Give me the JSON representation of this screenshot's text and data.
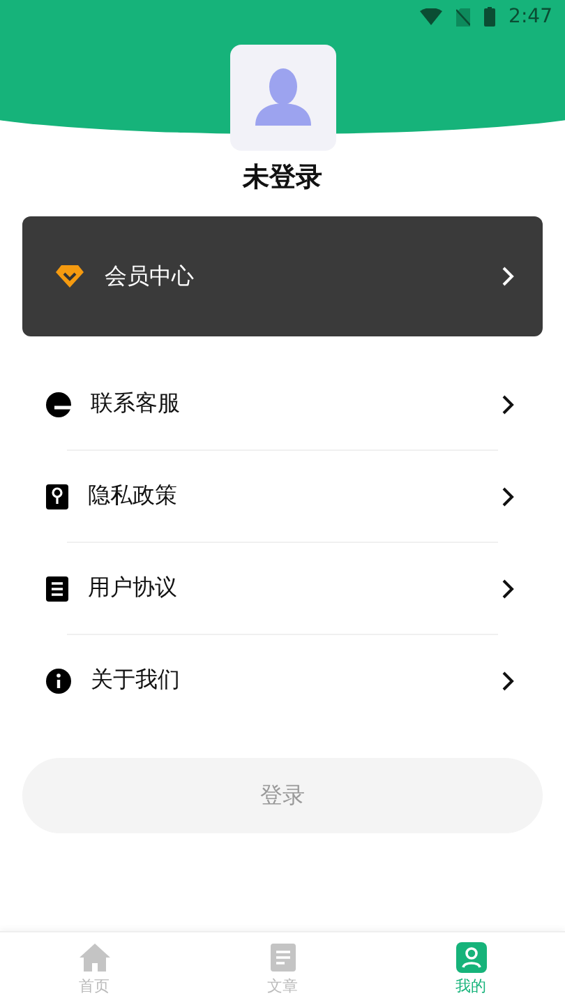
{
  "status_bar": {
    "time": "2:47"
  },
  "profile": {
    "name": "未登录"
  },
  "vip": {
    "label": "会员中心"
  },
  "menu": [
    {
      "label": "联系客服"
    },
    {
      "label": "隐私政策"
    },
    {
      "label": "用户协议"
    },
    {
      "label": "关于我们"
    }
  ],
  "login_button": {
    "label": "登录"
  },
  "bottom_nav": [
    {
      "label": "首页",
      "selected": false
    },
    {
      "label": "文章",
      "selected": false
    },
    {
      "label": "我的",
      "selected": true
    }
  ]
}
